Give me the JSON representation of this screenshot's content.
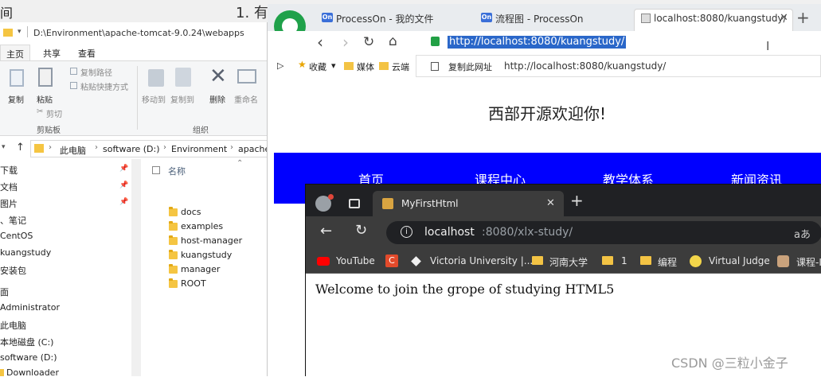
{
  "top_strip": {
    "left_char": "间",
    "doc_title": "1. 有"
  },
  "explorer": {
    "title_path": "D:\\Environment\\apache-tomcat-9.0.24\\webapps",
    "tabs": [
      "主页",
      "共享",
      "查看"
    ],
    "ribbon": {
      "copy": "复制",
      "paste": "粘贴",
      "copy_path": "复制路径",
      "paste_shortcut": "粘贴快捷方式",
      "cut": "剪切",
      "clipboard_group": "剪贴板",
      "move_to": "移动到",
      "copy_to": "复制到",
      "delete": "删除",
      "rename": "重命名",
      "organize_group": "组织"
    },
    "breadcrumbs": [
      "此电脑",
      "software (D:)",
      "Environment",
      "apache"
    ],
    "nav_items": [
      "下载",
      "文档",
      "图片",
      "、笔记",
      "CentOS",
      "kuangstudy",
      "安装包",
      "面",
      "Administrator",
      "此电脑",
      "本地磁盘 (C:)",
      "software (D:)",
      "Downloader"
    ],
    "column_header": "名称",
    "files": [
      "docs",
      "examples",
      "host-manager",
      "kuangstudy",
      "manager",
      "ROOT"
    ]
  },
  "browser1": {
    "tabs": [
      {
        "label": "ProcessOn - 我的文件",
        "badge": "On"
      },
      {
        "label": "流程图 - ProcessOn",
        "badge": "On"
      },
      {
        "label": "localhost:8080/kuangstudy/"
      }
    ],
    "new_tab": "+",
    "url": "http://localhost:8080/kuangstudy/",
    "dropdown": {
      "copy_label": "复制此网址",
      "url": "http://localhost:8080/kuangstudy/"
    },
    "bookmarks": [
      "收藏",
      "媒体",
      "云端"
    ],
    "page": {
      "heading": "西部开源欢迎你!",
      "nav": [
        "首页",
        "课程中心",
        "教学体系",
        "新闻资讯"
      ]
    }
  },
  "browser2": {
    "tab_title": "MyFirstHtml",
    "url_host": "localhost",
    "url_rest": ":8080/xlx-study/",
    "reader_label": "aあ",
    "bookmarks": [
      {
        "label": "YouTube",
        "icon": "youtube-icon"
      },
      {
        "label": "",
        "icon": "c-red-icon"
      },
      {
        "label": "Victoria University |...",
        "icon": "diamond-icon"
      },
      {
        "label": "河南大学",
        "icon": "folder-icon"
      },
      {
        "label": "1",
        "icon": "folder-icon"
      },
      {
        "label": "编程",
        "icon": "folder-icon"
      },
      {
        "label": "Virtual Judge",
        "icon": "vjudge-icon"
      },
      {
        "label": "课程-I",
        "icon": "avatar-icon"
      }
    ],
    "page_text": "Welcome to join the grope of studying HTML5"
  },
  "watermark": "CSDN @三粒小金子",
  "colors": {
    "nav_blue": "#0000ff",
    "url_highlight": "#2a67c9",
    "edge_dark": "#202124",
    "edge_toolbar": "#3c3c3c",
    "logo_green": "#1fa14a"
  }
}
